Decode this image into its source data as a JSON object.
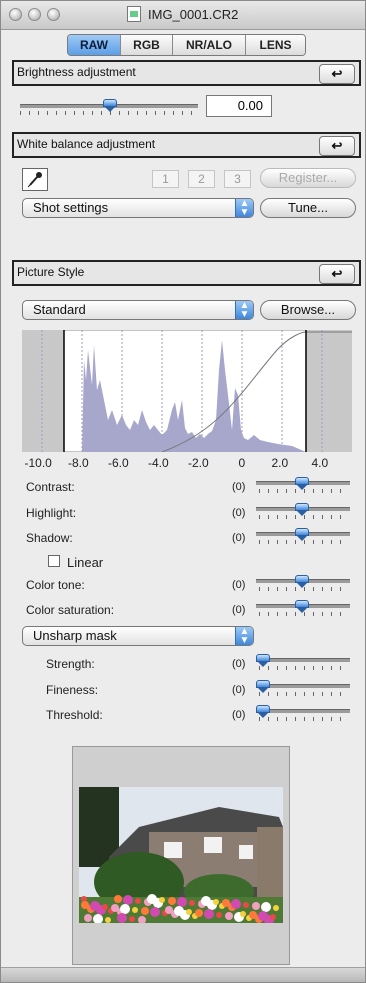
{
  "window": {
    "title": "IMG_0001.CR2"
  },
  "tabs": [
    {
      "label": "RAW",
      "active": true
    },
    {
      "label": "RGB",
      "active": false
    },
    {
      "label": "NR/ALO",
      "active": false
    },
    {
      "label": "LENS",
      "active": false
    }
  ],
  "brightness": {
    "header": "Brightness adjustment",
    "reset_icon": "↩",
    "value": "0.00"
  },
  "white_balance": {
    "header": "White balance adjustment",
    "reset_icon": "↩",
    "eyedropper_icon": "eyedropper-icon",
    "buttons": [
      "1",
      "2",
      "3"
    ],
    "register_label": "Register...",
    "preset": "Shot settings",
    "tune_label": "Tune..."
  },
  "picture_style": {
    "header": "Picture Style",
    "reset_icon": "↩",
    "style": "Standard",
    "browse_label": "Browse..."
  },
  "chart_data": {
    "type": "area",
    "title": "",
    "xlabel": "",
    "ylabel": "",
    "xlim": [
      -11,
      5.5
    ],
    "ticks": [
      "-10.0",
      "-8.0",
      "-6.0",
      "-4.0",
      "-2.0",
      "0",
      "2.0",
      "4.0"
    ],
    "tick_values": [
      -10,
      -8,
      -6,
      -4,
      -2,
      0,
      2,
      4
    ],
    "histogram_color": "#a7a7cc"
  },
  "adjustments": [
    {
      "label": "Contrast:",
      "value": "(0)"
    },
    {
      "label": "Highlight:",
      "value": "(0)"
    },
    {
      "label": "Shadow:",
      "value": "(0)"
    }
  ],
  "linear": {
    "label": "Linear",
    "checked": false
  },
  "color_adjust": [
    {
      "label": "Color tone:",
      "value": "(0)"
    },
    {
      "label": "Color saturation:",
      "value": "(0)"
    }
  ],
  "sharpness": {
    "mode": "Unsharp mask",
    "items": [
      {
        "label": "Strength:",
        "value": "(0)"
      },
      {
        "label": "Fineness:",
        "value": "(0)"
      },
      {
        "label": "Threshold:",
        "value": "(0)"
      }
    ]
  }
}
